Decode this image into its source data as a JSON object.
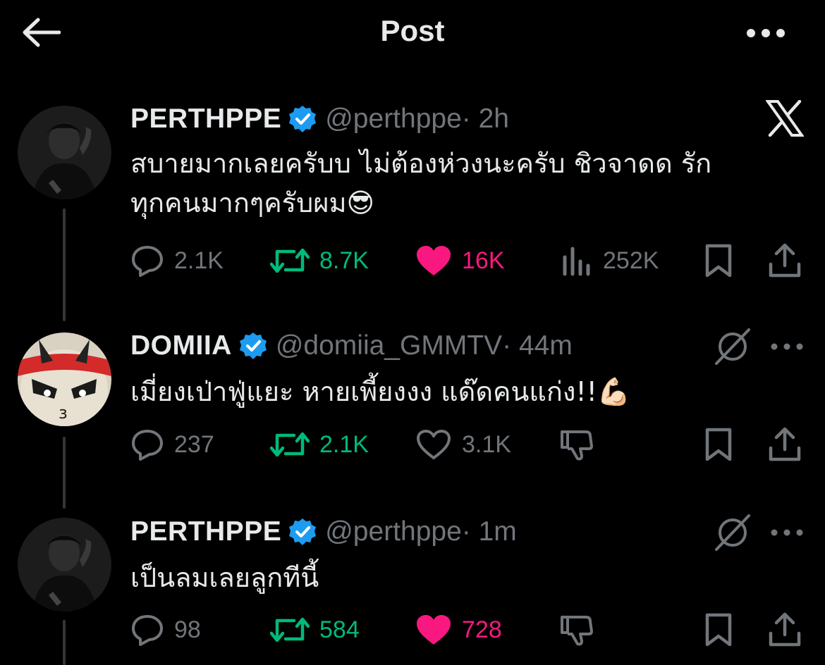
{
  "header": {
    "title": "Post"
  },
  "tweets": [
    {
      "name": "PERTHPPE",
      "handle": "@perthppe",
      "time": "· 2h",
      "text_line1": "สบายมากเลยครับบ ไม่ต้องห่วงนะครับ ชิวจาดด รัก",
      "text_line2": "ทุกคนมากๆครับผม",
      "emoji": "😎",
      "replies": "2.1K",
      "reposts": "8.7K",
      "likes": "16K",
      "views": "252K",
      "liked": true
    },
    {
      "name": "DOMIIA",
      "handle": "@domiia_GMMTV",
      "time": "· 44m",
      "text_line1": "เมี่ยงเป่าฟู่แยะ หายเพี้ยงงง แด๊ดคนแก่ง!!",
      "emoji": "💪🏻",
      "replies": "237",
      "reposts": "2.1K",
      "likes": "3.1K",
      "liked": false
    },
    {
      "name": "PERTHPPE",
      "handle": "@perthppe",
      "time": "· 1m",
      "text_line1": "เป็นลมเลยลูกทีนี้",
      "replies": "98",
      "reposts": "584",
      "likes": "728",
      "liked": true
    }
  ],
  "colors": {
    "background": "#000000",
    "verified": "#1d9bf0",
    "repost": "#00ba7c",
    "like": "#f91880",
    "muted": "#71767b"
  },
  "icons": [
    "back-arrow-icon",
    "more-icon",
    "x-logo-icon",
    "verified-badge-icon",
    "reply-icon",
    "repost-icon",
    "like-icon",
    "views-icon",
    "bookmark-icon",
    "share-icon",
    "grok-icon",
    "downvote-icon"
  ]
}
